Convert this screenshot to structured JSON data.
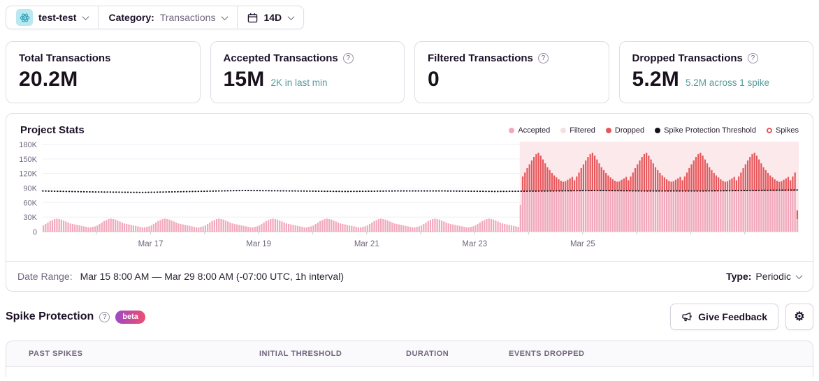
{
  "header": {
    "project": {
      "name": "test-test",
      "avatar_icon": "react-atom-icon"
    },
    "category_label": "Category:",
    "category_value": "Transactions",
    "period": "14D"
  },
  "cards": [
    {
      "title": "Total Transactions",
      "value": "20.2M"
    },
    {
      "title": "Accepted Transactions",
      "value": "15M",
      "sub": "2K in last min",
      "help_icon": "question-circle"
    },
    {
      "title": "Filtered Transactions",
      "value": "0",
      "help_icon": "question-circle"
    },
    {
      "title": "Dropped Transactions",
      "value": "5.2M",
      "sub": "5.2M across 1 spike",
      "help_icon": "question-circle"
    }
  ],
  "chart": {
    "title": "Project Stats",
    "legend": [
      {
        "label": "Accepted",
        "color": "#f1a8bb",
        "type": "dot"
      },
      {
        "label": "Filtered",
        "color": "#f8dde3",
        "type": "dot"
      },
      {
        "label": "Dropped",
        "color": "#e7565a",
        "type": "dot"
      },
      {
        "label": "Spike Protection Threshold",
        "color": "#16121c",
        "type": "dot"
      },
      {
        "label": "Spikes",
        "color": "#e7565a",
        "type": "ring"
      }
    ]
  },
  "chart_data": {
    "type": "bar",
    "title": "Project Stats",
    "x_start": "Mar 15 8:00 AM",
    "x_end": "Mar 29 8:00 AM",
    "interval_hours": 1,
    "hours_total": 336,
    "ylim_k": [
      0,
      180
    ],
    "ytick_labels": [
      "0",
      "30K",
      "60K",
      "90K",
      "120K",
      "150K",
      "180K"
    ],
    "xticks": [
      {
        "label": "Mar 17",
        "hour": 48
      },
      {
        "label": "Mar 19",
        "hour": 96
      },
      {
        "label": "Mar 21",
        "hour": 144
      },
      {
        "label": "Mar 23",
        "hour": 192
      },
      {
        "label": "Mar 25",
        "hour": 240
      }
    ],
    "minor_tick_every_hours": 24,
    "grid": true,
    "legend_position": "top-right",
    "accepted_daily_pattern_k": [
      13,
      12,
      11,
      10,
      9,
      9,
      10,
      11,
      13,
      16,
      19,
      22,
      24,
      26,
      27,
      26,
      25,
      23,
      21,
      19,
      17,
      16,
      15,
      14
    ],
    "pattern_start_hour_of_day": 8,
    "spike": {
      "start_hour": 212,
      "end_hour": 336
    },
    "ramp_bar": {
      "hour": 212,
      "accepted_k": 55,
      "dropped_k": 0
    },
    "accepted_spike_level_k": 84,
    "dropped_spike_pattern_k": [
      22,
      30,
      38,
      47,
      55,
      63,
      70,
      76,
      79,
      73,
      65,
      57,
      49,
      43,
      37,
      32,
      28,
      24,
      21,
      19,
      20,
      23,
      26,
      29
    ],
    "last_bar": {
      "accepted_k": 26,
      "dropped_k": 18
    },
    "threshold_points_k": [
      84,
      82,
      81,
      83,
      85,
      84,
      83,
      84,
      84,
      83,
      84,
      85,
      84,
      84,
      85,
      86
    ],
    "colors": {
      "accepted_bar": "#f1a8bb",
      "dropped_bar": "#e7565a",
      "threshold_line": "#16121c",
      "spike_region_bg": "#fbe9ec",
      "axis_line": "#cfc9d6",
      "gridline": "#f1eef4",
      "tick_text": "#71667e"
    }
  },
  "footer": {
    "date_range_label": "Date Range:",
    "date_range_value": "Mar 15 8:00 AM — Mar 29 8:00 AM (-07:00 UTC, 1h interval)",
    "type_label": "Type:",
    "type_value": "Periodic"
  },
  "spike_section": {
    "title": "Spike Protection",
    "beta_badge": "beta",
    "feedback_button": "Give Feedback",
    "settings_icon": "gear"
  },
  "table": {
    "columns": [
      "PAST SPIKES",
      "INITIAL THRESHOLD",
      "DURATION",
      "EVENTS DROPPED"
    ]
  }
}
